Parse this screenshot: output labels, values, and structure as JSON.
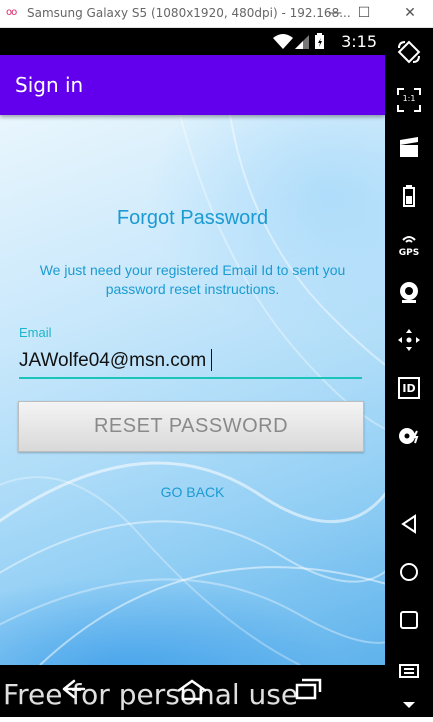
{
  "window": {
    "title": "Samsung Galaxy S5 (1080x1920, 480dpi) - 192.168...",
    "minimize_label": "—",
    "maximize_label": "☐",
    "close_label": "✕"
  },
  "statusbar": {
    "time": "3:15"
  },
  "appbar": {
    "title": "Sign in"
  },
  "form": {
    "heading": "Forgot Password",
    "subtext": "We just need your registered Email Id to sent you password reset instructions.",
    "email_label": "Email",
    "email_value": "JAWolfe04@msn.com",
    "reset_label": "RESET PASSWORD",
    "go_back_label": "GO BACK"
  },
  "toolbar": {
    "screen_size_label": "1:1",
    "gps_label": "GPS",
    "id_label": "ID"
  },
  "watermark": {
    "text": "Free for personal use"
  },
  "colors": {
    "appbar": "#6200ee",
    "accent_text": "#1b9bd1",
    "field_underline": "#1bc4b8"
  }
}
